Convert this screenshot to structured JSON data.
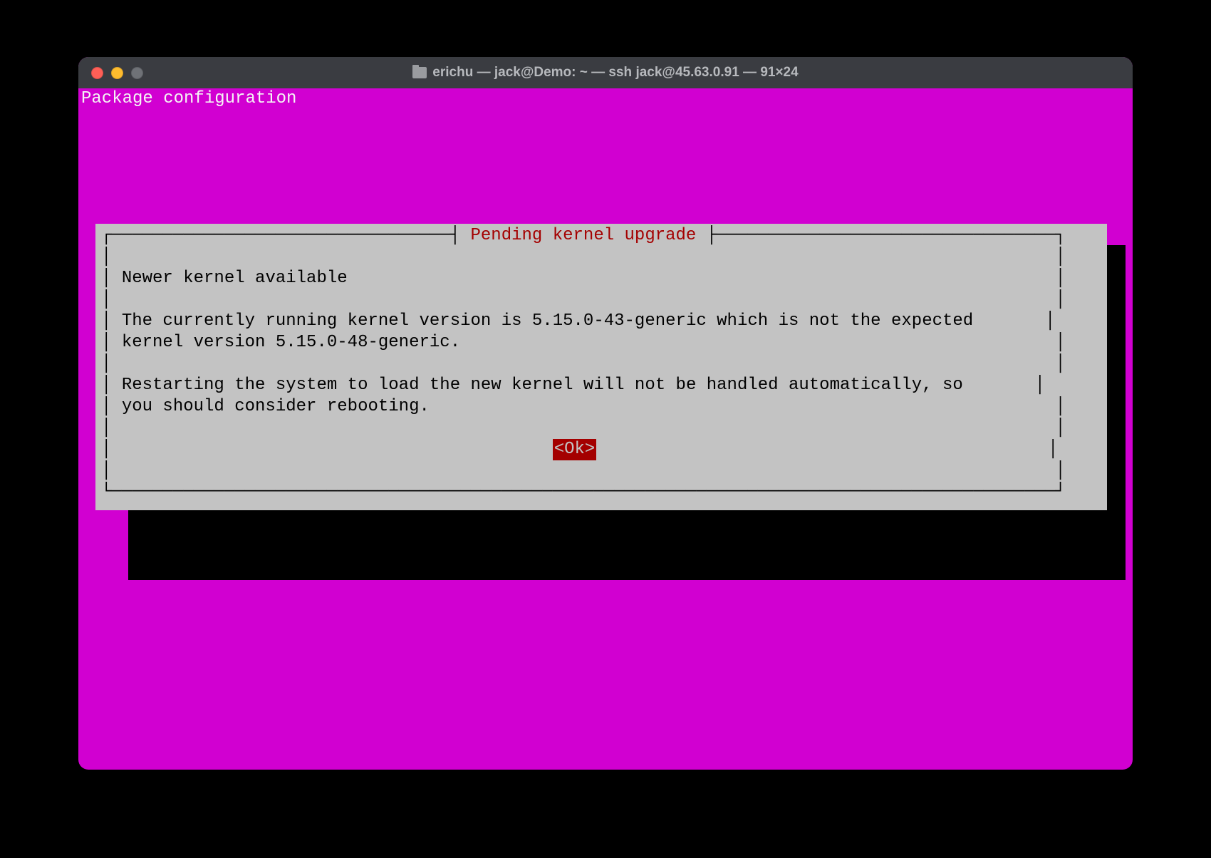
{
  "window": {
    "title": "erichu — jack@Demo: ~ — ssh jack@45.63.0.91 — 91×24"
  },
  "term": {
    "header": "Package configuration"
  },
  "dialog": {
    "title": "Pending kernel upgrade",
    "heading": "Newer kernel available",
    "body1": "The currently running kernel version is 5.15.0-43-generic which is not the expected",
    "body2": "kernel version 5.15.0-48-generic.",
    "body3": "Restarting the system to load the new kernel will not be handled automatically, so",
    "body4": "you should consider rebooting.",
    "ok": "<Ok>"
  }
}
